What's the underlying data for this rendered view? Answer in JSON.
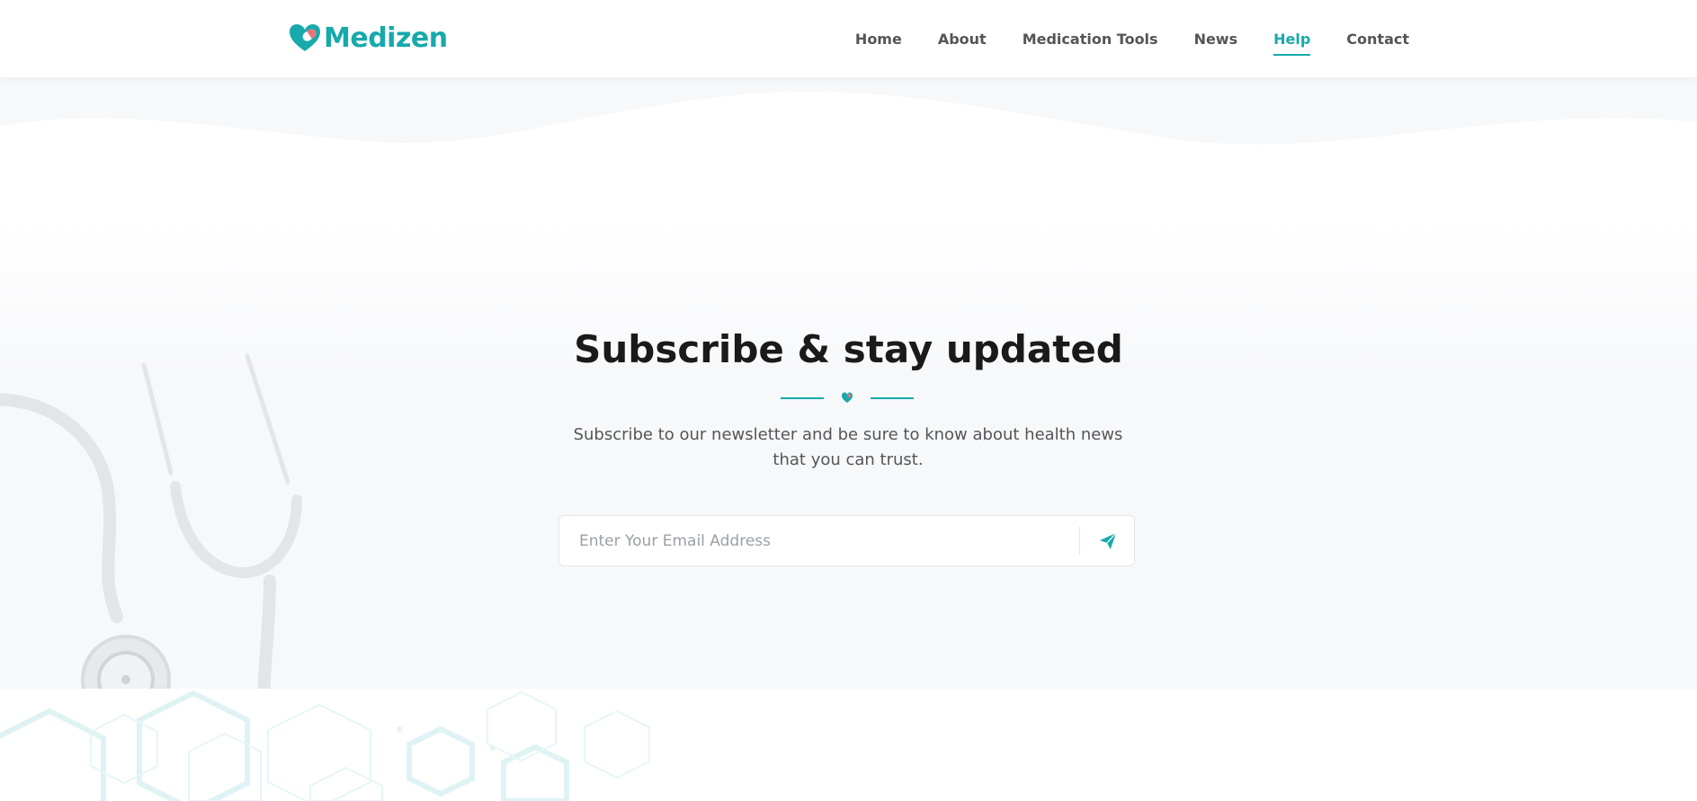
{
  "brand": {
    "name": "Medizen",
    "color": "#17a9ab",
    "logo_icon": "heart-pill-icon"
  },
  "nav": {
    "items": [
      {
        "label": "Home",
        "active": false
      },
      {
        "label": "About",
        "active": false
      },
      {
        "label": "Medication Tools",
        "active": false
      },
      {
        "label": "News",
        "active": false
      },
      {
        "label": "Help",
        "active": true
      },
      {
        "label": "Contact",
        "active": false
      }
    ]
  },
  "subscribe": {
    "title": "Subscribe & stay updated",
    "description": "Subscribe to our newsletter and be sure to know about health news that you can trust.",
    "email_placeholder": "Enter Your Email Address",
    "email_value": "",
    "send_icon": "paper-plane-icon",
    "divider_icon": "heart-icon"
  },
  "decor": {
    "hero_image": "stethoscope",
    "footer_pattern": "hexagon-pattern"
  }
}
